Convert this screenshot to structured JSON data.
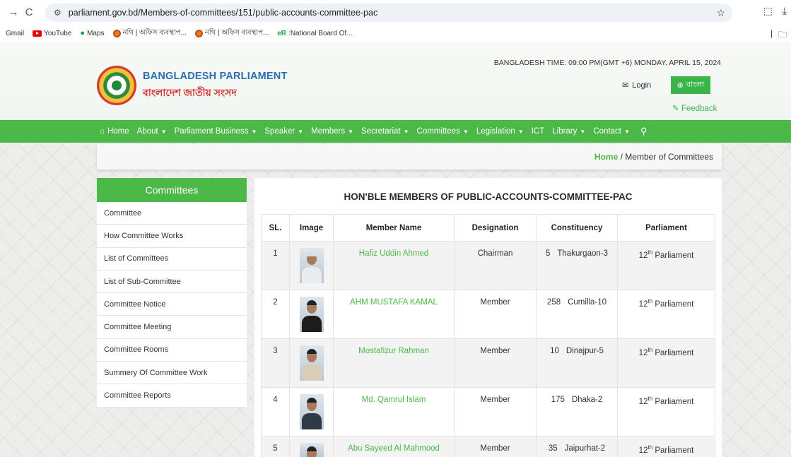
{
  "browser": {
    "url": "parliament.gov.bd/Members-of-committees/151/public-accounts-committee-pac",
    "bookmarks": [
      "Gmail",
      "YouTube",
      "Maps",
      "নথি | অফিস ব্যবস্থাপ...",
      "নথি | অফিস ব্যবস্থাপ...",
      ":National Board Of..."
    ]
  },
  "header": {
    "title": "BANGLADESH PARLIAMENT",
    "subtitle": "বাংলাদেশ জাতীয় সংসদ",
    "time": "BANGLADESH TIME: 09:00 PM(GMT +6) MONDAY, APRIL 15, 2024",
    "login": "Login",
    "language": "বাংলা",
    "feedback": "Feedback"
  },
  "nav": {
    "items": [
      "Home",
      "About",
      "Parliament Business",
      "Speaker",
      "Members",
      "Secretariat",
      "Committees",
      "Legislation",
      "ICT",
      "Library",
      "Contact"
    ]
  },
  "breadcrumb": {
    "home": "Home",
    "separator": "/",
    "current": "Member of Committees"
  },
  "sidebar": {
    "title": "Committees",
    "items": [
      "Committee",
      "How Committee Works",
      "List of Committees",
      "List of Sub-Committee",
      "Committee Notice",
      "Committee Meeting",
      "Committee Rooms",
      "Summery Of Committee Work",
      "Committee Reports"
    ]
  },
  "content": {
    "title": "HON'BLE MEMBERS OF PUBLIC-ACCOUNTS-COMMITTEE-PAC",
    "columns": [
      "SL.",
      "Image",
      "Member Name",
      "Designation",
      "Constituency",
      "Parliament"
    ],
    "rows": [
      {
        "sl": "1",
        "name": "Hafiz Uddin Ahmed",
        "designation": "Chairman",
        "const_no": "5",
        "const_name": "Thakurgaon-3",
        "parl_num": "12",
        "parl_sup": "th",
        "parl_word": "Parliament"
      },
      {
        "sl": "2",
        "name": "AHM MUSTAFA KAMAL",
        "designation": "Member",
        "const_no": "258",
        "const_name": "Cumilla-10",
        "parl_num": "12",
        "parl_sup": "th",
        "parl_word": "Parliament"
      },
      {
        "sl": "3",
        "name": "Mostafizur Rahman",
        "designation": "Member",
        "const_no": "10",
        "const_name": "Dinajpur-5",
        "parl_num": "12",
        "parl_sup": "th",
        "parl_word": "Parliament"
      },
      {
        "sl": "4",
        "name": "Md. Qamrul Islam",
        "designation": "Member",
        "const_no": "175",
        "const_name": "Dhaka-2",
        "parl_num": "12",
        "parl_sup": "th",
        "parl_word": "Parliament"
      },
      {
        "sl": "5",
        "name": "Abu Sayeed Al Mahmood",
        "designation": "Member",
        "const_no": "35",
        "const_name": "Jaipurhat-2",
        "parl_num": "12",
        "parl_sup": "th",
        "parl_word": "Parliament"
      }
    ]
  }
}
